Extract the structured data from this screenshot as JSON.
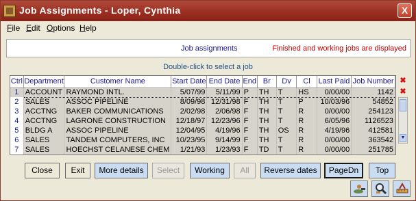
{
  "window": {
    "title": "Job Assignments  -  Loper, Cynthia",
    "close_glyph": "X"
  },
  "menu": [
    {
      "label": "File",
      "key": "F",
      "rest": "ile"
    },
    {
      "label": "Edit",
      "key": "E",
      "rest": "dit"
    },
    {
      "label": "Options",
      "key": "O",
      "rest": "ptions"
    },
    {
      "label": "Help",
      "key": "H",
      "rest": "elp"
    }
  ],
  "panel": {
    "title": "Job assignments",
    "status": "Finished and working jobs are displayed"
  },
  "hint": "Double-click to select a job",
  "table": {
    "columns": [
      "Ctrl",
      "Department",
      "Customer Name",
      "Start Date",
      "End Date",
      "End",
      "Br",
      "Dv",
      "Cl",
      "Last Paid",
      "Job Number"
    ],
    "rows": [
      [
        "1",
        "ACCOUNT",
        "RAYMOND INTL.",
        "5/07/99",
        "5/11/99",
        "P",
        "TH",
        "T",
        "HS",
        "0/00/00",
        "1142"
      ],
      [
        "2",
        "SALES",
        "ASSOC PIPELINE",
        "8/09/98",
        "12/31/98",
        "F",
        "TH",
        "T",
        "P",
        "10/03/96",
        "54852"
      ],
      [
        "3",
        "ACCTNG",
        "BAKER COMMUNICATIONS",
        "2/02/98",
        "2/06/98",
        "F",
        "TH",
        "T",
        "R",
        "0/00/00",
        "254123"
      ],
      [
        "4",
        "ACCTNG",
        "LAGRONE CONSTRUCTION",
        "12/18/97",
        "12/23/96",
        "F",
        "TH",
        "T",
        "R",
        "6/05/96",
        "1126523"
      ],
      [
        "5",
        "BLDG A",
        "ASSOC PIPELINE",
        "12/04/95",
        "4/19/96",
        "F",
        "TH",
        "OS",
        "R",
        "4/19/96",
        "412581"
      ],
      [
        "6",
        "SALES",
        "TANDEM COMPUTERS, INC",
        "10/23/95",
        "9/14/99",
        "F",
        "TH",
        "T",
        "R",
        "0/00/00",
        "363542"
      ],
      [
        "7",
        "SALES",
        "HOECHST CELANESE CHEM",
        "1/21/93",
        "1/23/93",
        "F",
        "TD",
        "T",
        "R",
        "0/00/00",
        "251785"
      ]
    ],
    "selected_row": 0
  },
  "side": {
    "delete_glyph": "✖",
    "scroll_down_glyph": "▼"
  },
  "buttons": {
    "close": "Close",
    "exit": "Exit",
    "more_details": "More details",
    "select": "Select",
    "working": "Working",
    "all": "All",
    "reverse_dates": "Reverse dates",
    "pagedn": "PageDn",
    "top": "Top"
  },
  "tools": [
    "person-search-icon",
    "magnifier-icon",
    "ruler-icon"
  ],
  "colors": {
    "title_bar": "#9a2d20",
    "accent_blue": "#c9dcf2",
    "status_red": "#c00000",
    "header_blue": "#1a1a8a"
  }
}
